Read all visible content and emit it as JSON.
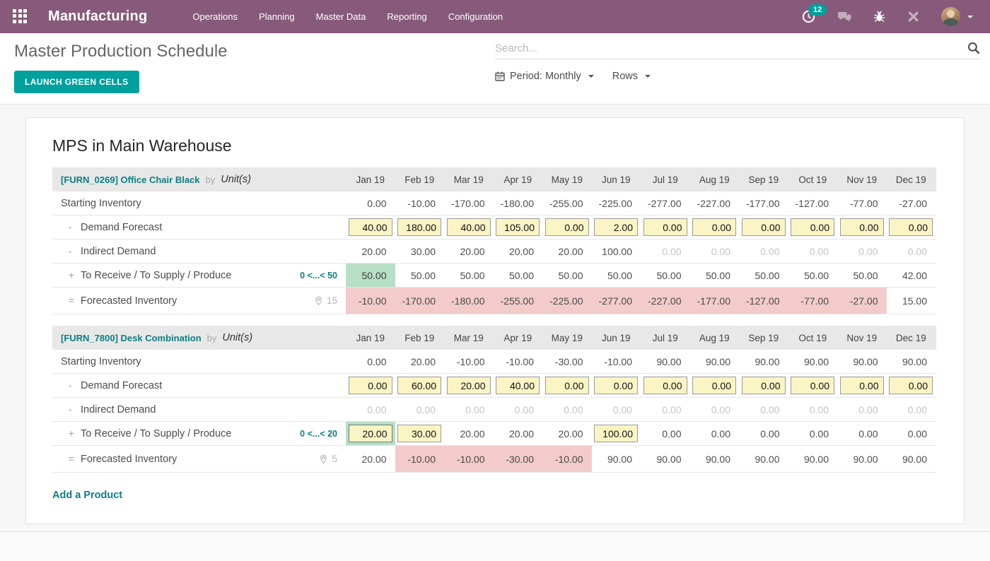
{
  "nav": {
    "app_name": "Manufacturing",
    "menus": [
      "Operations",
      "Planning",
      "Master Data",
      "Reporting",
      "Configuration"
    ],
    "activity_badge": "12"
  },
  "control_panel": {
    "title": "Master Production Schedule",
    "launch_button": "LAUNCH GREEN CELLS",
    "search_placeholder": "Search...",
    "period_filter": "Period: Monthly",
    "rows_filter": "Rows"
  },
  "colors": {
    "nav_bg": "#875A7B",
    "accent_teal": "#00A09D",
    "link_teal": "#0d7e83",
    "cell_ok_bg": "#b7dfc5",
    "cell_alert_bg": "#f2cbca",
    "input_bg": "#fbf5c5"
  },
  "icons": {
    "apps": "apps-grid-icon",
    "activity": "activity-clock-icon",
    "messages": "messages-icon",
    "bug": "bug-icon",
    "tools": "tools-icon",
    "search": "search-icon",
    "calendar": "calendar-icon",
    "pin": "pin-icon"
  },
  "mps": {
    "heading": "MPS in Main Warehouse",
    "add_product": "Add a Product",
    "months": [
      "Jan 19",
      "Feb 19",
      "Mar 19",
      "Apr 19",
      "May 19",
      "Jun 19",
      "Jul 19",
      "Aug 19",
      "Sep 19",
      "Oct 19",
      "Nov 19",
      "Dec 19"
    ],
    "products": [
      {
        "code_name": "[FURN_0269] Office Chair Black",
        "by": "by",
        "uom": "Unit(s)",
        "rows": [
          {
            "id": "starting-inventory",
            "prefix": "",
            "label": "Starting Inventory",
            "cells": [
              [
                "0.00",
                "text"
              ],
              [
                "-10.00",
                "text"
              ],
              [
                "-170.00",
                "text"
              ],
              [
                "-180.00",
                "text"
              ],
              [
                "-255.00",
                "text"
              ],
              [
                "-225.00",
                "text"
              ],
              [
                "-277.00",
                "text"
              ],
              [
                "-227.00",
                "text"
              ],
              [
                "-177.00",
                "text"
              ],
              [
                "-127.00",
                "text"
              ],
              [
                "-77.00",
                "text"
              ],
              [
                "-27.00",
                "text"
              ]
            ]
          },
          {
            "id": "demand-forecast",
            "prefix": "-",
            "label": "Demand Forecast",
            "cells": [
              [
                "40.00",
                "input"
              ],
              [
                "180.00",
                "input"
              ],
              [
                "40.00",
                "input"
              ],
              [
                "105.00",
                "input"
              ],
              [
                "0.00",
                "input"
              ],
              [
                "2.00",
                "input"
              ],
              [
                "0.00",
                "input"
              ],
              [
                "0.00",
                "input"
              ],
              [
                "0.00",
                "input"
              ],
              [
                "0.00",
                "input"
              ],
              [
                "0.00",
                "input"
              ],
              [
                "0.00",
                "input"
              ]
            ]
          },
          {
            "id": "indirect-demand",
            "prefix": "-",
            "label": "Indirect Demand",
            "cells": [
              [
                "20.00",
                "text"
              ],
              [
                "30.00",
                "text"
              ],
              [
                "20.00",
                "text"
              ],
              [
                "20.00",
                "text"
              ],
              [
                "20.00",
                "text"
              ],
              [
                "100.00",
                "text"
              ],
              [
                "0.00",
                "muted"
              ],
              [
                "0.00",
                "muted"
              ],
              [
                "0.00",
                "muted"
              ],
              [
                "0.00",
                "muted"
              ],
              [
                "0.00",
                "muted"
              ],
              [
                "0.00",
                "muted"
              ]
            ]
          },
          {
            "id": "to-receive",
            "prefix": "+",
            "label": "To Receive / To Supply / Produce",
            "range": "0 <...< 50",
            "cells": [
              [
                "50.00",
                "ok"
              ],
              [
                "50.00",
                "text"
              ],
              [
                "50.00",
                "text"
              ],
              [
                "50.00",
                "text"
              ],
              [
                "50.00",
                "text"
              ],
              [
                "50.00",
                "text"
              ],
              [
                "50.00",
                "text"
              ],
              [
                "50.00",
                "text"
              ],
              [
                "50.00",
                "text"
              ],
              [
                "50.00",
                "text"
              ],
              [
                "50.00",
                "text"
              ],
              [
                "42.00",
                "text"
              ]
            ]
          },
          {
            "id": "forecasted-inventory",
            "prefix": "=",
            "label": "Forecasted Inventory",
            "pin": "15",
            "cells": [
              [
                "-10.00",
                "alert"
              ],
              [
                "-170.00",
                "alert"
              ],
              [
                "-180.00",
                "alert"
              ],
              [
                "-255.00",
                "alert"
              ],
              [
                "-225.00",
                "alert"
              ],
              [
                "-277.00",
                "alert"
              ],
              [
                "-227.00",
                "alert"
              ],
              [
                "-177.00",
                "alert"
              ],
              [
                "-127.00",
                "alert"
              ],
              [
                "-77.00",
                "alert"
              ],
              [
                "-27.00",
                "alert"
              ],
              [
                "15.00",
                "text"
              ]
            ]
          }
        ]
      },
      {
        "code_name": "[FURN_7800] Desk Combination",
        "by": "by",
        "uom": "Unit(s)",
        "rows": [
          {
            "id": "starting-inventory",
            "prefix": "",
            "label": "Starting Inventory",
            "cells": [
              [
                "0.00",
                "text"
              ],
              [
                "20.00",
                "text"
              ],
              [
                "-10.00",
                "text"
              ],
              [
                "-10.00",
                "text"
              ],
              [
                "-30.00",
                "text"
              ],
              [
                "-10.00",
                "text"
              ],
              [
                "90.00",
                "text"
              ],
              [
                "90.00",
                "text"
              ],
              [
                "90.00",
                "text"
              ],
              [
                "90.00",
                "text"
              ],
              [
                "90.00",
                "text"
              ],
              [
                "90.00",
                "text"
              ]
            ]
          },
          {
            "id": "demand-forecast",
            "prefix": "-",
            "label": "Demand Forecast",
            "cells": [
              [
                "0.00",
                "input"
              ],
              [
                "60.00",
                "input"
              ],
              [
                "20.00",
                "input"
              ],
              [
                "40.00",
                "input"
              ],
              [
                "0.00",
                "input"
              ],
              [
                "0.00",
                "input"
              ],
              [
                "0.00",
                "input"
              ],
              [
                "0.00",
                "input"
              ],
              [
                "0.00",
                "input"
              ],
              [
                "0.00",
                "input"
              ],
              [
                "0.00",
                "input"
              ],
              [
                "0.00",
                "input"
              ]
            ]
          },
          {
            "id": "indirect-demand",
            "prefix": "-",
            "label": "Indirect Demand",
            "cells": [
              [
                "0.00",
                "muted"
              ],
              [
                "0.00",
                "muted"
              ],
              [
                "0.00",
                "muted"
              ],
              [
                "0.00",
                "muted"
              ],
              [
                "0.00",
                "muted"
              ],
              [
                "0.00",
                "muted"
              ],
              [
                "0.00",
                "muted"
              ],
              [
                "0.00",
                "muted"
              ],
              [
                "0.00",
                "muted"
              ],
              [
                "0.00",
                "muted"
              ],
              [
                "0.00",
                "muted"
              ],
              [
                "0.00",
                "muted"
              ]
            ]
          },
          {
            "id": "to-receive",
            "prefix": "+",
            "label": "To Receive / To Supply / Produce",
            "range": "0 <...< 20",
            "cells": [
              [
                "20.00",
                "ok-input"
              ],
              [
                "30.00",
                "input"
              ],
              [
                "20.00",
                "text"
              ],
              [
                "20.00",
                "text"
              ],
              [
                "20.00",
                "text"
              ],
              [
                "100.00",
                "input"
              ],
              [
                "0.00",
                "text"
              ],
              [
                "0.00",
                "text"
              ],
              [
                "0.00",
                "text"
              ],
              [
                "0.00",
                "text"
              ],
              [
                "0.00",
                "text"
              ],
              [
                "0.00",
                "text"
              ]
            ]
          },
          {
            "id": "forecasted-inventory",
            "prefix": "=",
            "label": "Forecasted Inventory",
            "pin": "5",
            "cells": [
              [
                "20.00",
                "text"
              ],
              [
                "-10.00",
                "alert"
              ],
              [
                "-10.00",
                "alert"
              ],
              [
                "-30.00",
                "alert"
              ],
              [
                "-10.00",
                "alert"
              ],
              [
                "90.00",
                "text"
              ],
              [
                "90.00",
                "text"
              ],
              [
                "90.00",
                "text"
              ],
              [
                "90.00",
                "text"
              ],
              [
                "90.00",
                "text"
              ],
              [
                "90.00",
                "text"
              ],
              [
                "90.00",
                "text"
              ]
            ]
          }
        ]
      }
    ]
  }
}
